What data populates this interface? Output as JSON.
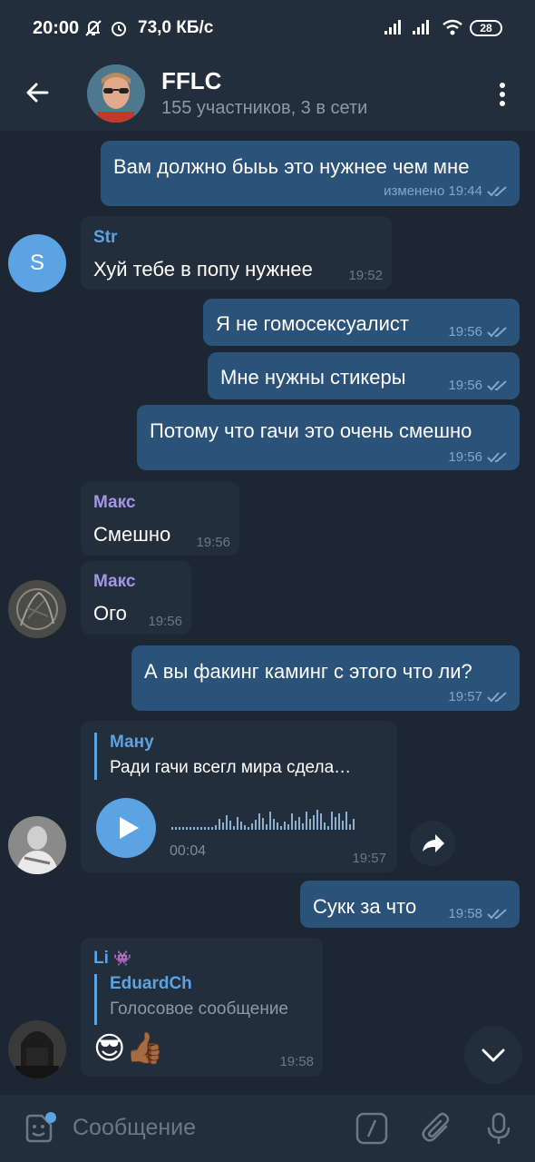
{
  "status": {
    "time": "20:00",
    "net_speed": "73,0 КБ/с",
    "battery": "28"
  },
  "chat": {
    "title": "FFLC",
    "subtitle": "155 участников, 3 в сети"
  },
  "messages": [
    {
      "text": "Вам должно быьь это нужнее чем мне",
      "meta": "изменено 19:44"
    },
    {
      "sender": "Str",
      "avatar_letter": "S",
      "text": "Хуй тебе в попу нужнее",
      "time": "19:52"
    },
    {
      "text": "Я не гомосексуалист",
      "time": "19:56"
    },
    {
      "text": "Мне нужны стикеры",
      "time": "19:56"
    },
    {
      "text": "Потому что гачи это очень смешно",
      "time": "19:56"
    },
    {
      "sender": "Макс",
      "text": "Смешно",
      "time": "19:56"
    },
    {
      "sender": "Макс",
      "text": "Ого",
      "time": "19:56"
    },
    {
      "text": "А вы факинг каминг с этого что ли?",
      "time": "19:57"
    },
    {
      "reply_name": "Ману",
      "reply_text": "Ради гачи всегл мира сдела…",
      "duration": "00:04",
      "time": "19:57"
    },
    {
      "text": "Сукк за что",
      "time": "19:58"
    },
    {
      "sender": "Li",
      "sender_badge": "👾",
      "reply_name": "EduardCh",
      "reply_text": "Голосовое сообщение",
      "text": "😎👍🏾",
      "time": "19:58"
    }
  ],
  "input": {
    "placeholder": "Сообщение"
  },
  "colors": {
    "background": "#1d2733",
    "outgoing": "#2b5278",
    "incoming": "#222e3b",
    "accent": "#5ca3e3",
    "maks": "#a695e7"
  }
}
